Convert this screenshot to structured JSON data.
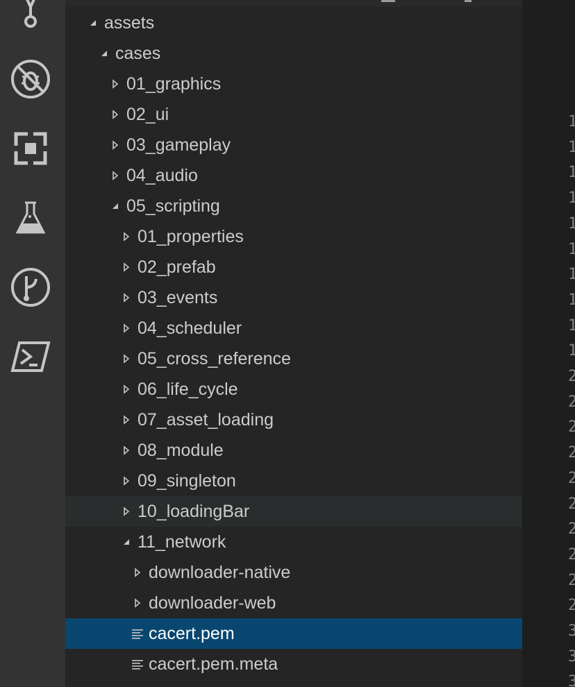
{
  "activity_bar": {
    "icons": [
      {
        "name": "source-control-icon"
      },
      {
        "name": "debug-disabled-icon"
      },
      {
        "name": "extensions-icon"
      },
      {
        "name": "test-flask-icon"
      },
      {
        "name": "git-graph-icon"
      },
      {
        "name": "powershell-icon"
      }
    ]
  },
  "explorer": {
    "tree": [
      {
        "label": "assets",
        "level": 0,
        "kind": "folder",
        "expanded": true
      },
      {
        "label": "cases",
        "level": 1,
        "kind": "folder",
        "expanded": true
      },
      {
        "label": "01_graphics",
        "level": 2,
        "kind": "folder",
        "expanded": false
      },
      {
        "label": "02_ui",
        "level": 2,
        "kind": "folder",
        "expanded": false
      },
      {
        "label": "03_gameplay",
        "level": 2,
        "kind": "folder",
        "expanded": false
      },
      {
        "label": "04_audio",
        "level": 2,
        "kind": "folder",
        "expanded": false
      },
      {
        "label": "05_scripting",
        "level": 2,
        "kind": "folder",
        "expanded": true
      },
      {
        "label": "01_properties",
        "level": 3,
        "kind": "folder",
        "expanded": false
      },
      {
        "label": "02_prefab",
        "level": 3,
        "kind": "folder",
        "expanded": false
      },
      {
        "label": "03_events",
        "level": 3,
        "kind": "folder",
        "expanded": false
      },
      {
        "label": "04_scheduler",
        "level": 3,
        "kind": "folder",
        "expanded": false
      },
      {
        "label": "05_cross_reference",
        "level": 3,
        "kind": "folder",
        "expanded": false
      },
      {
        "label": "06_life_cycle",
        "level": 3,
        "kind": "folder",
        "expanded": false
      },
      {
        "label": "07_asset_loading",
        "level": 3,
        "kind": "folder",
        "expanded": false
      },
      {
        "label": "08_module",
        "level": 3,
        "kind": "folder",
        "expanded": false
      },
      {
        "label": "09_singleton",
        "level": 3,
        "kind": "folder",
        "expanded": false
      },
      {
        "label": "10_loadingBar",
        "level": 3,
        "kind": "folder",
        "expanded": false,
        "hovered": true
      },
      {
        "label": "11_network",
        "level": 3,
        "kind": "folder",
        "expanded": true
      },
      {
        "label": "downloader-native",
        "level": 4,
        "kind": "folder",
        "expanded": false
      },
      {
        "label": "downloader-web",
        "level": 4,
        "kind": "folder",
        "expanded": false
      },
      {
        "label": "cacert.pem",
        "level": 4,
        "kind": "file",
        "selected": true
      },
      {
        "label": "cacert.pem.meta",
        "level": 4,
        "kind": "file"
      }
    ]
  },
  "editor": {
    "line_numbers": [
      "1",
      "1",
      "1",
      "1",
      "1",
      "1",
      "1",
      "1",
      "1",
      "1",
      "2",
      "2",
      "2",
      "2",
      "2",
      "2",
      "2",
      "2",
      "2",
      "2",
      "3",
      "3",
      "3"
    ]
  },
  "colors": {
    "activity_bar_bg": "#333333",
    "sidebar_bg": "#252526",
    "editor_bg": "#1e1e1e",
    "selection_bg": "#094771",
    "hover_bg": "#2a2d2e",
    "text": "#cccccc",
    "icon": "#c5c5c5"
  }
}
